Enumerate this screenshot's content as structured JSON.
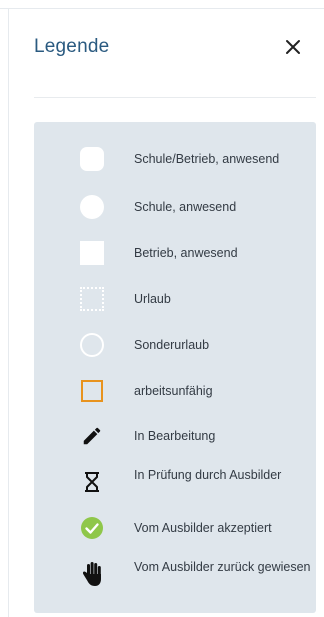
{
  "header": {
    "title": "Legende",
    "close_icon": "close-icon"
  },
  "colors": {
    "title": "#2a5a80",
    "panel_bg": "#dfe6ec",
    "unfit_orange": "#e8931e",
    "approved_green": "#8fc74a"
  },
  "legend": {
    "items": [
      {
        "icon": "rounded-square-icon",
        "label": "Schule/Betrieb, anwesend"
      },
      {
        "icon": "filled-circle-icon",
        "label": "Schule, anwesend"
      },
      {
        "icon": "filled-square-icon",
        "label": "Betrieb, anwesend"
      },
      {
        "icon": "dotted-square-icon",
        "label": "Urlaub"
      },
      {
        "icon": "outline-circle-icon",
        "label": "Sonderurlaub"
      },
      {
        "icon": "orange-outline-square-icon",
        "label": "arbeitsunfähig"
      },
      {
        "icon": "pencil-icon",
        "label": "In Bearbeitung"
      },
      {
        "icon": "hourglass-icon",
        "label": "In Prüfung durch Ausbilder"
      },
      {
        "icon": "check-circle-icon",
        "label": "Vom Ausbilder akzeptiert"
      },
      {
        "icon": "hand-icon",
        "label": "Vom Ausbilder zurück gewiesen"
      }
    ]
  }
}
